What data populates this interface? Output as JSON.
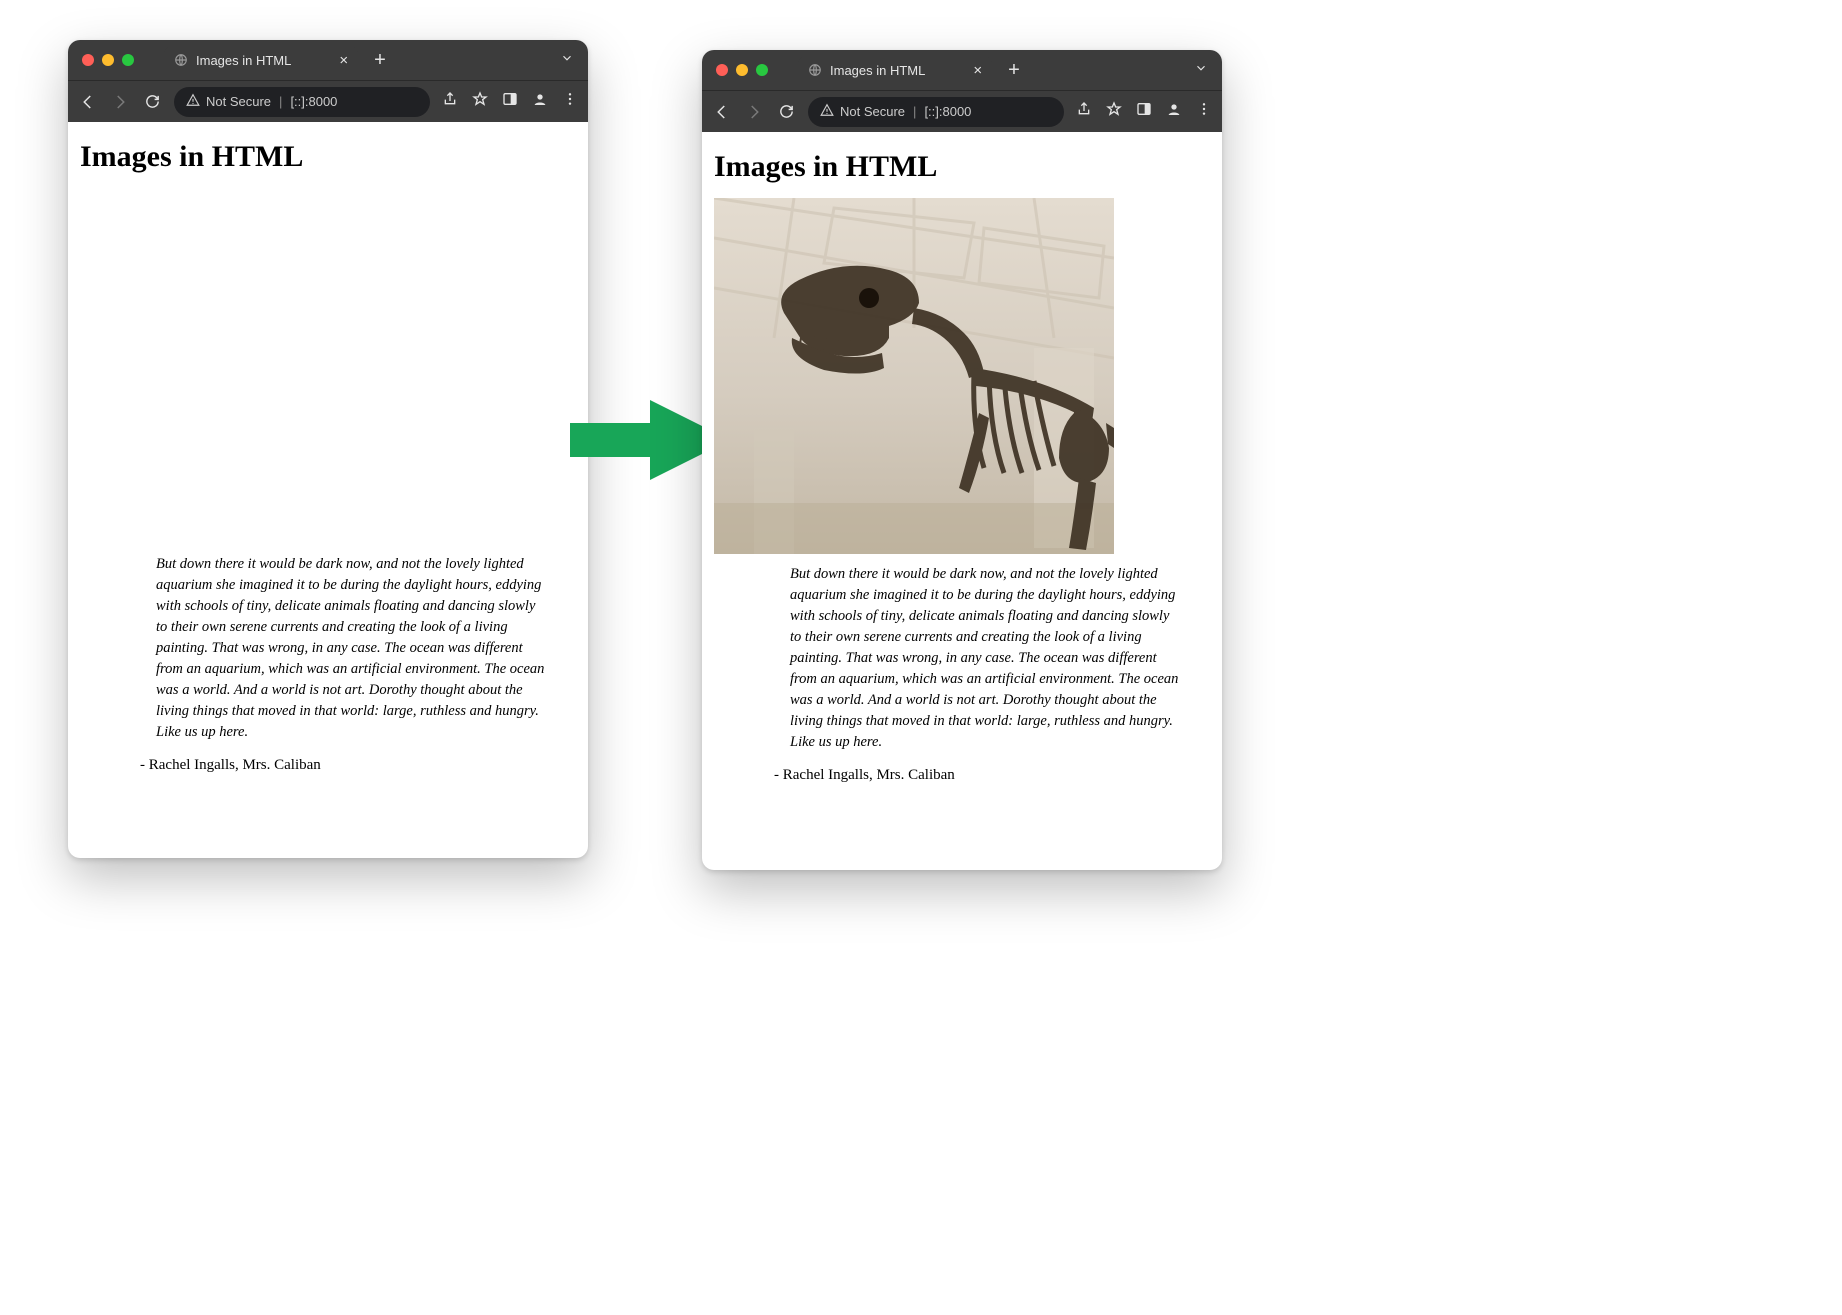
{
  "left_window": {
    "tab_title": "Images in HTML",
    "url_security_label": "Not Secure",
    "url_text": "[::]:8000",
    "page": {
      "heading": "Images in HTML",
      "image_loaded": false,
      "quote_text": "But down there it would be dark now, and not the lovely lighted aquarium she imagined it to be during the daylight hours, eddying with schools of tiny, delicate animals floating and dancing slowly to their own serene currents and creating the look of a living painting. That was wrong, in any case. The ocean was different from an aquarium, which was an artificial environment. The ocean was a world. And a world is not art. Dorothy thought about the living things that moved in that world: large, ruthless and hungry. Like us up here.",
      "attribution": "- Rachel Ingalls, Mrs. Caliban"
    }
  },
  "right_window": {
    "tab_title": "Images in HTML",
    "url_security_label": "Not Secure",
    "url_text": "[::]:8000",
    "page": {
      "heading": "Images in HTML",
      "image_loaded": true,
      "image_alt": "dinosaur-skeleton-museum",
      "quote_text": "But down there it would be dark now, and not the lovely lighted aquarium she imagined it to be during the daylight hours, eddying with schools of tiny, delicate animals floating and dancing slowly to their own serene currents and creating the look of a living painting. That was wrong, in any case. The ocean was different from an aquarium, which was an artificial environment. The ocean was a world. And a world is not art. Dorothy thought about the living things that moved in that world: large, ruthless and hungry. Like us up here.",
      "attribution": "- Rachel Ingalls, Mrs. Caliban"
    }
  },
  "arrow_color": "#18a658"
}
